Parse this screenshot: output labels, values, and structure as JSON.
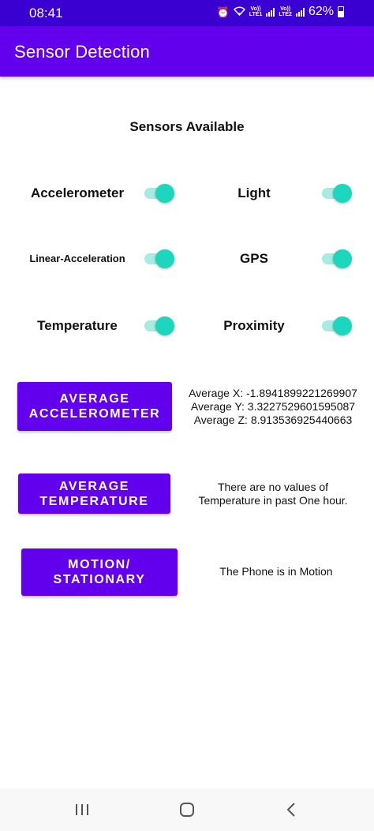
{
  "status_bar": {
    "time": "08:41",
    "net1_top": "Vo))",
    "net1_bottom": "LTE1",
    "net2_top": "Vo))",
    "net2_bottom": "LTE2",
    "battery": "62%"
  },
  "app_bar": {
    "title": "Sensor Detection"
  },
  "section_title": "Sensors Available",
  "sensors": [
    {
      "label": "Accelerometer",
      "enabled": true
    },
    {
      "label": "Light",
      "enabled": true
    },
    {
      "label": "Linear-Acceleration",
      "enabled": true
    },
    {
      "label": "GPS",
      "enabled": true
    },
    {
      "label": "Temperature",
      "enabled": true
    },
    {
      "label": "Proximity",
      "enabled": true
    }
  ],
  "actions": [
    {
      "button_line1": "AVERAGE",
      "button_line2": "ACCELEROMETER",
      "result_lines": [
        "Average X: -1.8941899221269907",
        "Average Y: 3.3227529601595087",
        "Average Z: 8.913536925440663"
      ]
    },
    {
      "button_line1": "AVERAGE",
      "button_line2": "TEMPERATURE",
      "result_lines": [
        "There are no values of",
        "Temperature in past One hour."
      ]
    },
    {
      "button_line1": "MOTION/",
      "button_line2": "STATIONARY",
      "result_lines": [
        "The Phone is in Motion"
      ]
    }
  ],
  "colors": {
    "status_bar": "#3a00d2",
    "primary": "#6200ee",
    "switch_thumb": "#1dd6be",
    "switch_track": "#a8ebe0"
  },
  "nav_bar": {
    "icons": [
      "recent-apps-icon",
      "home-icon",
      "back-icon"
    ]
  }
}
